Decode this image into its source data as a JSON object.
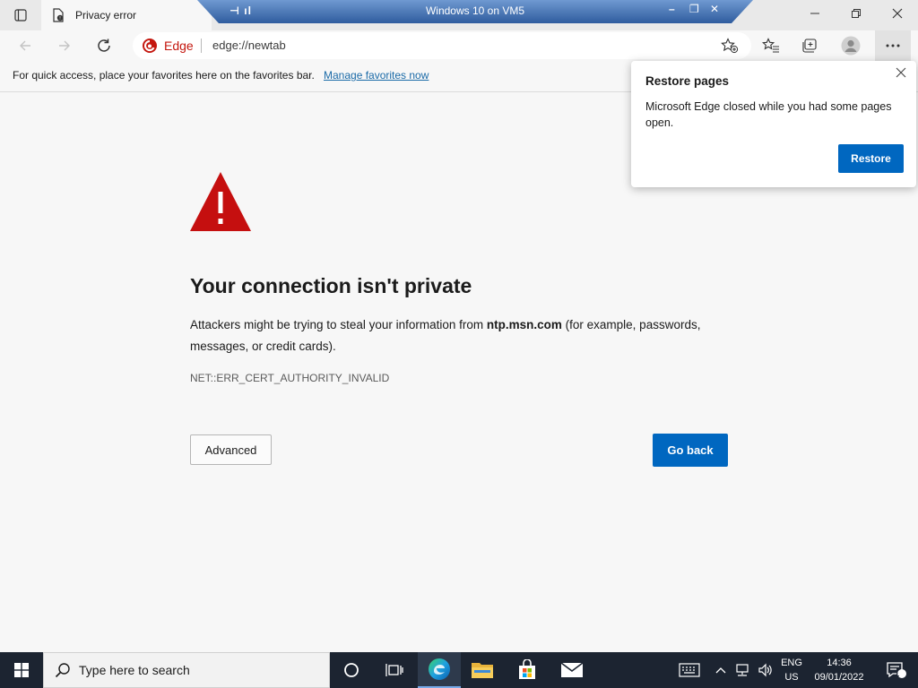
{
  "window": {
    "tab_title": "Privacy error",
    "vm_title": "Windows 10 on VM5"
  },
  "address_bar": {
    "brand": "Edge",
    "url": "edge://newtab"
  },
  "favorites_bar": {
    "message": "For quick access, place your favorites here on the favorites bar.",
    "link": "Manage favorites now"
  },
  "error": {
    "title": "Your connection isn't private",
    "desc_prefix": "Attackers might be trying to steal your information from ",
    "host": "ntp.msn.com",
    "desc_suffix": " (for example, passwords, messages, or credit cards).",
    "code": "NET::ERR_CERT_AUTHORITY_INVALID",
    "advanced_label": "Advanced",
    "go_back_label": "Go back"
  },
  "restore_popup": {
    "title": "Restore pages",
    "text": "Microsoft Edge closed while you had some pages open.",
    "button": "Restore"
  },
  "taskbar": {
    "search_placeholder": "Type here to search",
    "lang_line1": "ENG",
    "lang_line2": "US",
    "time": "14:36",
    "date": "09/01/2022",
    "notification_count": "1"
  },
  "colors": {
    "accent": "#0067c0",
    "warning": "#c50f0f",
    "taskbar": "#1c2431"
  }
}
